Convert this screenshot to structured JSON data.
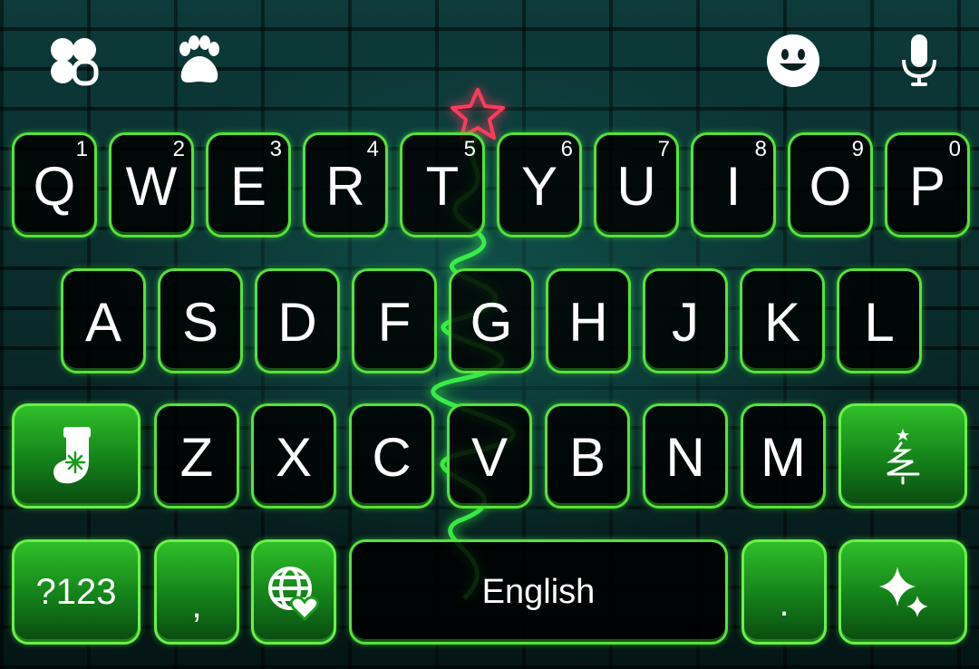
{
  "toolbar": {
    "icons": [
      "clover-theme-icon",
      "paw-sticker-icon",
      "emoji-icon",
      "microphone-icon"
    ]
  },
  "keyboard": {
    "row1": [
      {
        "label": "Q",
        "hint": "1"
      },
      {
        "label": "W",
        "hint": "2"
      },
      {
        "label": "E",
        "hint": "3"
      },
      {
        "label": "R",
        "hint": "4"
      },
      {
        "label": "T",
        "hint": "5"
      },
      {
        "label": "Y",
        "hint": "6"
      },
      {
        "label": "U",
        "hint": "7"
      },
      {
        "label": "I",
        "hint": "8"
      },
      {
        "label": "O",
        "hint": "9"
      },
      {
        "label": "P",
        "hint": "0"
      }
    ],
    "row2": [
      "A",
      "S",
      "D",
      "F",
      "G",
      "H",
      "J",
      "K",
      "L"
    ],
    "row3": [
      "Z",
      "X",
      "C",
      "V",
      "B",
      "N",
      "M"
    ],
    "shift_icon": "stocking-icon",
    "delete_icon": "christmas-tree-icon",
    "symbols_label": "?123",
    "comma_label": ",",
    "language_icon": "globe-heart-icon",
    "space_label": "English",
    "period_label": ".",
    "enter_icon": "sparkle-icon"
  },
  "colors": {
    "key_border": "#55e23a",
    "key_fill": "#000000",
    "func_key_fill": "#1a9a1e",
    "wall": "#0a2a2a",
    "tree_neon": "#3cff4a",
    "star_neon": "#ff3b5c",
    "text": "#ffffff"
  }
}
